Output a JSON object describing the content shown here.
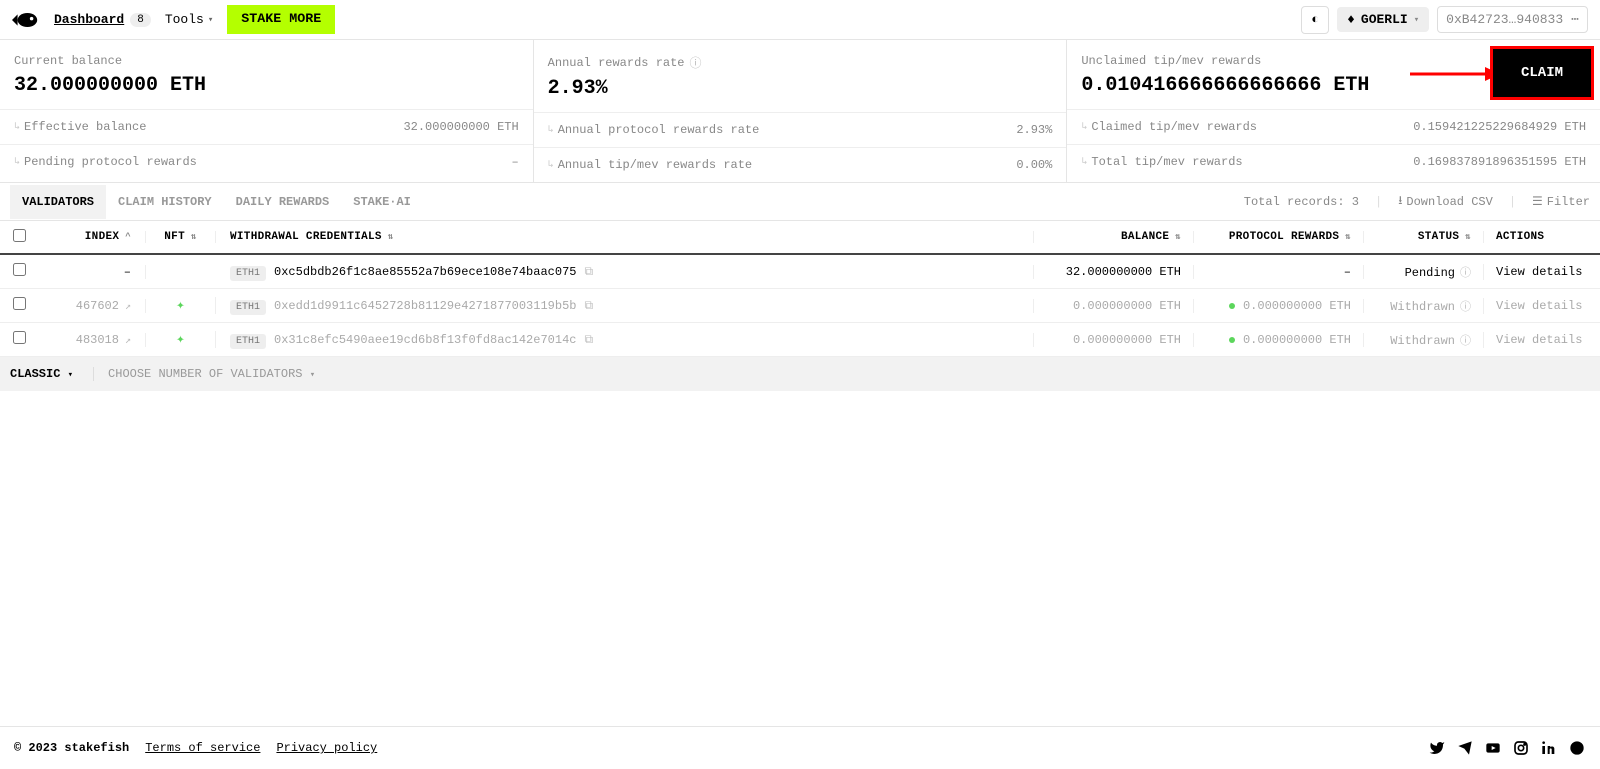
{
  "header": {
    "dashboard": "Dashboard",
    "dashboard_badge": "8",
    "tools": "Tools",
    "stake_more": "STAKE MORE",
    "network": "GOERLI",
    "address": "0xB42723…940833"
  },
  "summary": {
    "col1": {
      "label": "Current balance",
      "value": "32.000000000 ETH",
      "sub1_label": "Effective balance",
      "sub1_value": "32.000000000 ETH",
      "sub2_label": "Pending protocol rewards",
      "sub2_value": "–"
    },
    "col2": {
      "label": "Annual rewards rate",
      "value": "2.93%",
      "sub1_label": "Annual protocol rewards rate",
      "sub1_value": "2.93%",
      "sub2_label": "Annual tip/mev rewards rate",
      "sub2_value": "0.00%"
    },
    "col3": {
      "label": "Unclaimed tip/mev rewards",
      "value": "0.010416666666666666 ETH",
      "sub1_label": "Claimed tip/mev rewards",
      "sub1_value": "0.159421225229684929 ETH",
      "sub2_label": "Total tip/mev rewards",
      "sub2_value": "0.169837891896351595 ETH",
      "claim_btn": "CLAIM"
    }
  },
  "tabs": {
    "validators": "VALIDATORS",
    "claim_history": "CLAIM HISTORY",
    "daily_rewards": "DAILY REWARDS",
    "stake_ai": "STAKE·AI",
    "total_records": "Total records: 3",
    "download": "Download CSV",
    "filter": "Filter"
  },
  "table": {
    "head": {
      "index": "INDEX",
      "nft": "NFT",
      "wc": "WITHDRAWAL CREDENTIALS",
      "balance": "BALANCE",
      "protocol_rewards": "PROTOCOL REWARDS",
      "status": "STATUS",
      "actions": "ACTIONS"
    },
    "eth1_badge": "ETH1",
    "rows": [
      {
        "index": "–",
        "nft": false,
        "wc": "0xc5dbdb26f1c8ae85552a7b69ece108e74baac075",
        "balance": "32.000000000 ETH",
        "pr": "–",
        "pr_dot": false,
        "status": "Pending",
        "faded": false,
        "action": "View details"
      },
      {
        "index": "467602",
        "nft": true,
        "wc": "0xedd1d9911c6452728b81129e4271877003119b5b",
        "balance": "0.000000000 ETH",
        "pr": "0.000000000 ETH",
        "pr_dot": true,
        "status": "Withdrawn",
        "faded": true,
        "action": "View details"
      },
      {
        "index": "483018",
        "nft": true,
        "wc": "0x31c8efc5490aee19cd6b8f13f0fd8ac142e7014c",
        "balance": "0.000000000 ETH",
        "pr": "0.000000000 ETH",
        "pr_dot": true,
        "status": "Withdrawn",
        "faded": true,
        "action": "View details"
      }
    ]
  },
  "footer_bar": {
    "classic": "CLASSIC",
    "choose": "CHOOSE NUMBER OF VALIDATORS"
  },
  "page_footer": {
    "copyright": "© 2023 stakefish",
    "terms": "Terms of service",
    "privacy": "Privacy policy"
  }
}
